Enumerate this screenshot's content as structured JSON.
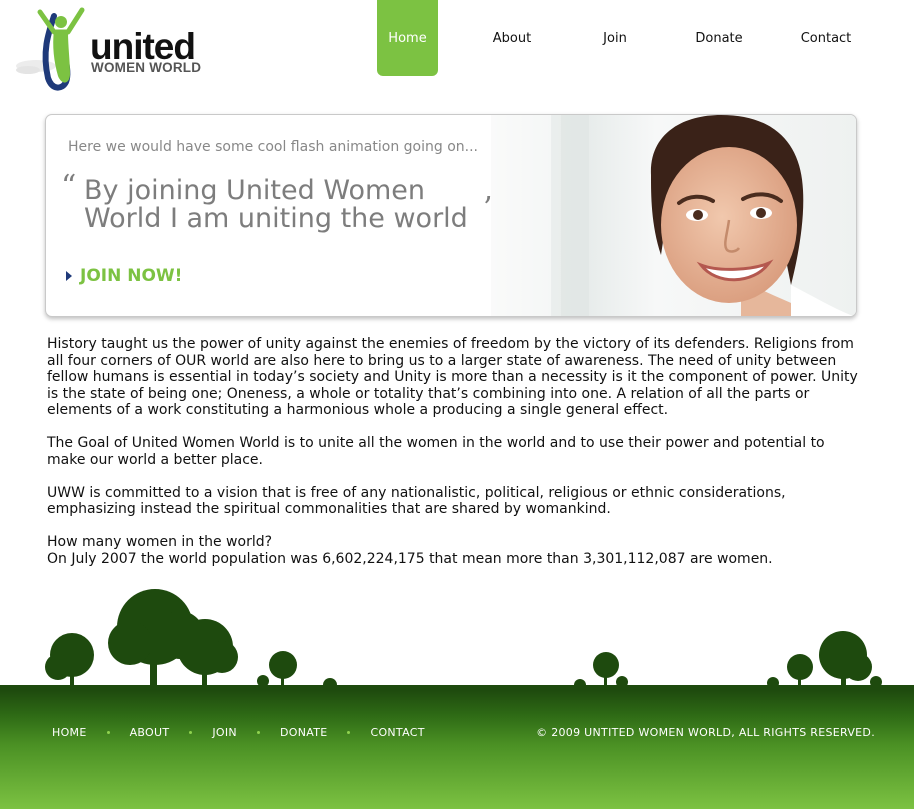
{
  "brand": {
    "name": "united",
    "subtitle": "WOMEN WORLD"
  },
  "nav": {
    "items": [
      {
        "label": "Home",
        "active": true
      },
      {
        "label": "About"
      },
      {
        "label": "Join"
      },
      {
        "label": "Donate"
      },
      {
        "label": "Contact"
      }
    ]
  },
  "banner": {
    "note": "Here we would have some cool flash animation going on...",
    "quote_open": "“",
    "quote_line1": "By joining United Women",
    "quote_line2": "World I am uniting the world",
    "quote_close": "”",
    "cta": "JOIN NOW!"
  },
  "content": {
    "paragraphs": [
      "History taught us the power of unity against the enemies of freedom by the victory of its defenders. Religions from all four corners of OUR world are also here to bring us to a larger state of awareness. The need of unity between fellow humans is essential in today’s society and Unity is more than a necessity is it the component of power. Unity is the state of being one; Oneness, a whole or totality that’s combining into one. A relation of all the parts or elements of a work constituting a harmonious whole a producing a single general effect.",
      "The Goal of United Women World is to unite all the women in the world and to use their power and potential to make our world a better place.",
      "UWW is committed to a vision that is free of any nationalistic, political, religious or ethnic considerations, emphasizing instead the spiritual commonalities that are shared by womankind."
    ],
    "question": "How many women in the world?",
    "answer": "On July 2007 the world population was 6,602,224,175 that mean more than 3,301,112,087 are women."
  },
  "footer": {
    "links": [
      "HOME",
      "ABOUT",
      "JOIN",
      "DONATE",
      "CONTACT"
    ],
    "copyright": "© 2009 UNTITED WOMEN WORLD, ALL RIGHTS RESERVED."
  },
  "colors": {
    "accent_green": "#7cc242",
    "dark_green": "#1e4a0e",
    "logo_blue": "#1f3a7a"
  }
}
